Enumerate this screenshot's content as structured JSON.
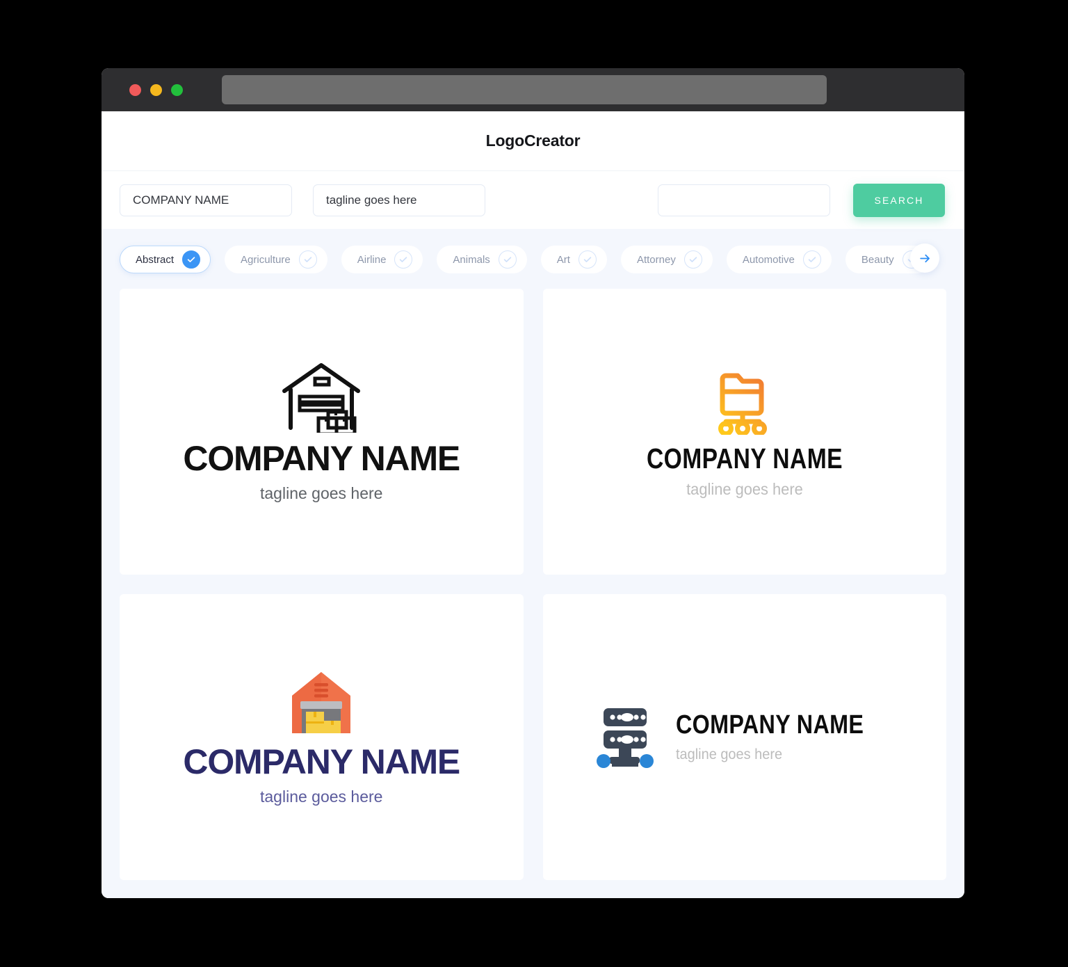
{
  "window": {
    "traffic_lights": [
      {
        "name": "close",
        "color": "#f05a5a"
      },
      {
        "name": "minimize",
        "color": "#f5b81e"
      },
      {
        "name": "maximize",
        "color": "#22c03c"
      }
    ],
    "url_value": ""
  },
  "header": {
    "brand": "LogoCreator"
  },
  "search": {
    "company_value": "COMPANY NAME",
    "company_placeholder": "COMPANY NAME",
    "tagline_value": "tagline goes here",
    "tagline_placeholder": "tagline goes here",
    "extra_value": "",
    "extra_placeholder": "",
    "button_label": "SEARCH",
    "button_color": "#4ecca0"
  },
  "categories": {
    "next_icon": "arrow-right-icon",
    "accent_color": "#3b95f5",
    "items": [
      {
        "label": "Abstract",
        "selected": true
      },
      {
        "label": "Agriculture",
        "selected": false
      },
      {
        "label": "Airline",
        "selected": false
      },
      {
        "label": "Animals",
        "selected": false
      },
      {
        "label": "Art",
        "selected": false
      },
      {
        "label": "Attorney",
        "selected": false
      },
      {
        "label": "Automotive",
        "selected": false
      },
      {
        "label": "Beauty",
        "selected": false
      }
    ]
  },
  "results": [
    {
      "icon": "warehouse-outline-icon",
      "name": "COMPANY NAME",
      "tagline": "tagline goes here",
      "name_color": "#111111",
      "tagline_color": "#5f6368"
    },
    {
      "icon": "folder-network-icon",
      "name": "COMPANY NAME",
      "tagline": "tagline goes here",
      "name_color": "#0d0d0d",
      "tagline_color": "#bcbcbc"
    },
    {
      "icon": "warehouse-flat-icon",
      "name": "COMPANY NAME",
      "tagline": "tagline goes here",
      "name_color": "#2b2a68",
      "tagline_color": "#5b5b9c"
    },
    {
      "icon": "server-network-icon",
      "name": "COMPANY NAME",
      "tagline": "tagline goes here",
      "name_color": "#0d0d0d",
      "tagline_color": "#bcbcbc"
    }
  ]
}
